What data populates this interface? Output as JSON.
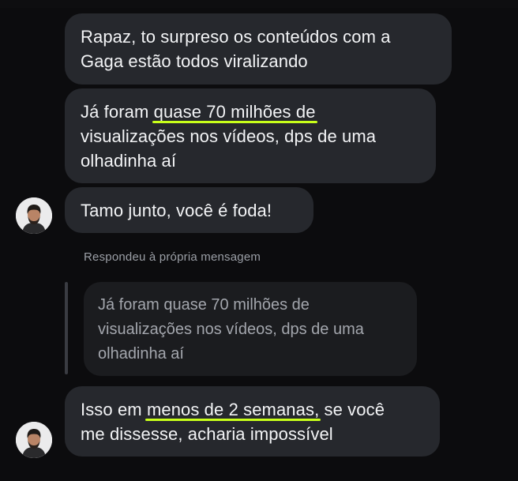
{
  "conversation": {
    "messages": [
      {
        "id": "msg1",
        "text": "Rapaz, to surpreso os conteúdos com a Gaga estão todos viralizando"
      },
      {
        "id": "msg2",
        "before": "Já foram ",
        "highlight": "quase 70 milhões de",
        "after": "visualizações nos vídeos, dps de uma olhadinha aí"
      },
      {
        "id": "msg3",
        "text": "Tamo junto, você é foda!"
      },
      {
        "id": "msg4",
        "before": "Isso em ",
        "highlight": "menos de 2 semanas,",
        "after_inline": " se você",
        "after": "me dissesse, acharia impossível"
      }
    ],
    "reply": {
      "label": "Respondeu à própria mensagem",
      "quoted_line1": "Já foram quase 70 milhões de",
      "quoted_line2": "visualizações nos vídeos, dps de uma",
      "quoted_line3": "olhadinha aí"
    }
  },
  "colors": {
    "background": "#0c0c0e",
    "bubble": "#26282d",
    "quoted_bubble": "#1b1c1f",
    "highlight_underline": "#c8ff1a",
    "text": "#f3f4f6",
    "muted_text": "#9b9fa6"
  },
  "icons": {
    "avatar": "user-avatar-photo"
  }
}
